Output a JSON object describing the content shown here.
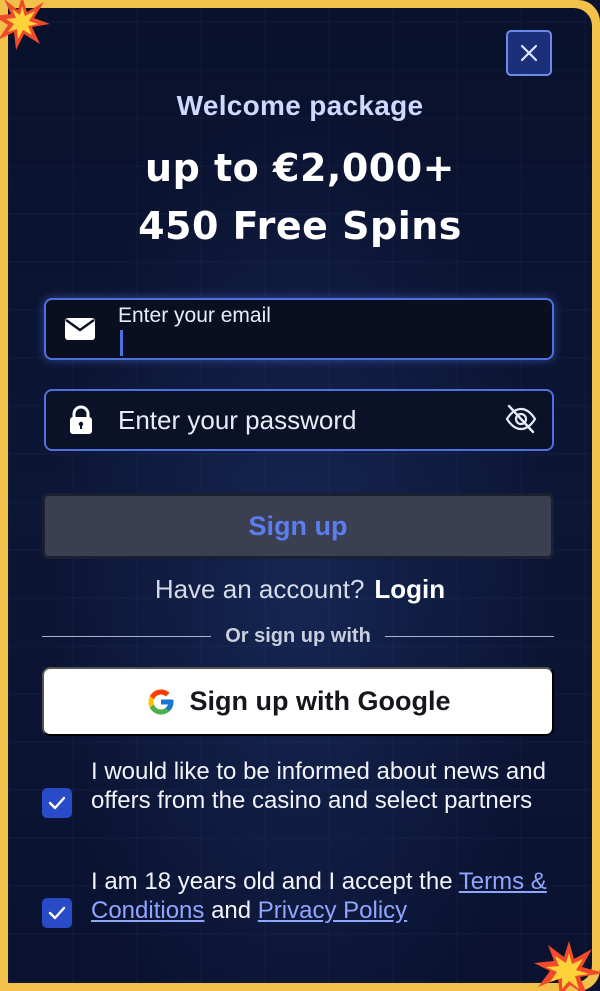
{
  "modal": {
    "close_icon": "close-icon",
    "header": {
      "subtitle": "Welcome package",
      "offer_line1": "up to €2,000+",
      "offer_line2": "450 Free Spins"
    },
    "email": {
      "label": "Enter your email",
      "value": "",
      "icon": "envelope-icon"
    },
    "password": {
      "placeholder": "Enter your password",
      "value": "",
      "icon": "lock-icon",
      "toggle_icon": "eye-slash-icon"
    },
    "signup_button": "Sign up",
    "account_prompt": {
      "text": "Have an account?",
      "login_link": "Login"
    },
    "divider_text": "Or sign up with",
    "google_button": {
      "label": "Sign up with Google",
      "icon": "google-icon"
    },
    "consents": [
      {
        "checked": true,
        "text": "I would like to be informed about news and offers from the casino and select partners"
      },
      {
        "checked": true,
        "prefix": "I am 18 years old and I accept the ",
        "terms_link": "Terms & Conditions",
        "middle": " and ",
        "privacy_link": "Privacy Policy"
      }
    ]
  },
  "colors": {
    "frame": "#f2c14a",
    "background": "#0b1330",
    "accent": "#4d6fe0",
    "checkbox": "#2a4bc7",
    "link": "#8fa6ff"
  }
}
